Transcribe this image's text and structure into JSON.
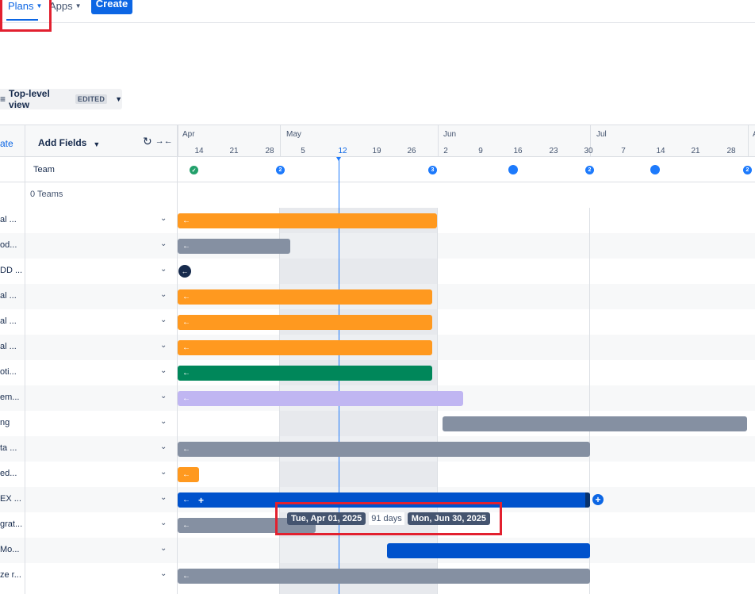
{
  "nav": {
    "plans_label": "Plans",
    "apps_label": "Apps",
    "create_label": "Create"
  },
  "view": {
    "label": "Top-level view",
    "badge": "EDITED"
  },
  "header": {
    "date_col_label": "ate",
    "add_fields_label": "Add Fields"
  },
  "timeline": {
    "months": [
      "Apr",
      "May",
      "Jun",
      "Jul",
      "A"
    ],
    "days": [
      "14",
      "21",
      "28",
      "5",
      "12",
      "19",
      "26",
      "2",
      "9",
      "16",
      "23",
      "30",
      "7",
      "14",
      "21",
      "28"
    ],
    "today_label": "12"
  },
  "team_row": {
    "label": "Team",
    "markers": [
      "",
      "2",
      "3",
      "",
      "2",
      "",
      "2"
    ]
  },
  "teams_summary": "0 Teams",
  "rows": [
    {
      "label": "al ...",
      "color": "#ff991f"
    },
    {
      "label": "od...",
      "color": "#8590a2"
    },
    {
      "label": "DD ...",
      "color": "#172b4d"
    },
    {
      "label": "al ...",
      "color": "#ff991f"
    },
    {
      "label": "al ...",
      "color": "#ff991f"
    },
    {
      "label": "al ...",
      "color": "#ff991f"
    },
    {
      "label": "oti...",
      "color": "#00875a"
    },
    {
      "label": "em...",
      "color": "#c0b6f2"
    },
    {
      "label": "ng",
      "color": "#8590a2"
    },
    {
      "label": "ta ...",
      "color": "#8590a2"
    },
    {
      "label": "ed...",
      "color": "#ff991f"
    },
    {
      "label": "EX ...",
      "color": "#0052cc"
    },
    {
      "label": "grat...",
      "color": "#8590a2"
    },
    {
      "label": "Mo...",
      "color": "#0052cc"
    },
    {
      "label": "ze r...",
      "color": "#8590a2"
    }
  ],
  "tooltip": {
    "start": "Tue, Apr 01, 2025",
    "duration": "91 days",
    "end": "Mon, Jun 30, 2025"
  },
  "icons": {
    "dropdown": "chevron-down-icon",
    "refresh": "refresh-icon",
    "collapse": "collapse-icon",
    "arrow_left": "arrow-left-icon",
    "plus": "plus-icon"
  }
}
